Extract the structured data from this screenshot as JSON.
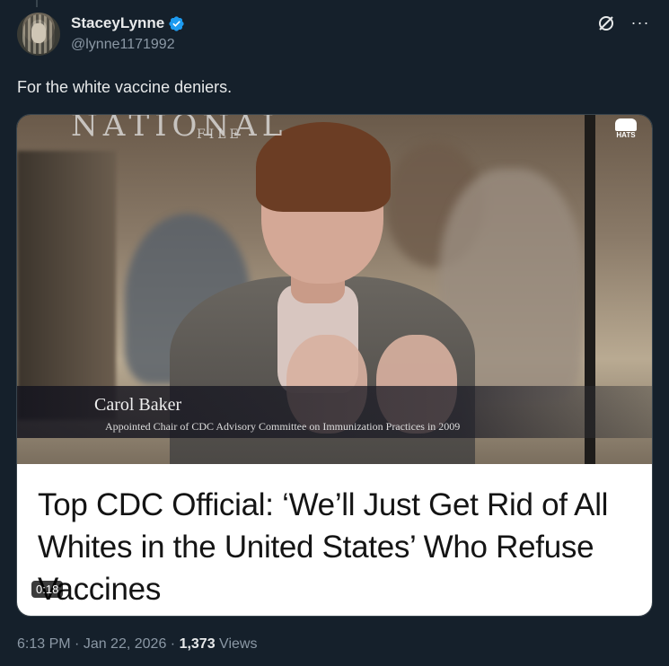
{
  "author": {
    "display_name": "StaceyLynne",
    "handle": "@lynne1171992",
    "verified": true
  },
  "icons": {
    "verified": "verified-badge-icon",
    "grok": "grok-icon",
    "more": "more-icon"
  },
  "tweet": {
    "text": "For the white vaccine deniers."
  },
  "media": {
    "watermark": "NATIONAL",
    "watermark_sub": "FILE",
    "logo_label": "HATS",
    "caption_name": "Carol Baker",
    "caption_title": "Appointed Chair of CDC Advisory Committee on Immunization Practices in 2009",
    "headline": "Top CDC Official: ‘We’ll Just Get Rid of All Whites in the United States’ Who Refuse Vaccines",
    "duration": "0:18"
  },
  "meta": {
    "time": "6:13 PM",
    "separator": " · ",
    "date": "Jan 22, 2026",
    "views_count": "1,373",
    "views_label": " Views"
  },
  "colors": {
    "background": "#15202b",
    "text": "#e7e9ea",
    "secondary": "#8b98a5",
    "verified": "#1d9bf0"
  }
}
